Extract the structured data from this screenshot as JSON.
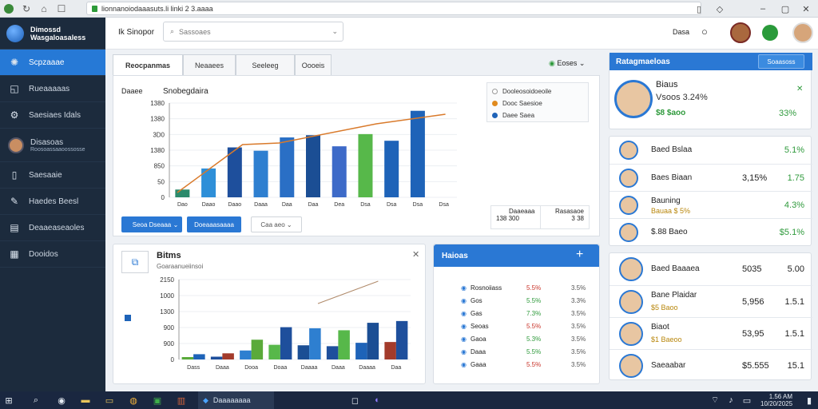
{
  "browser": {
    "url": "lionnanoiodaaasuts.li linki 2 3.aaaa"
  },
  "sidebar": {
    "brand_line1": "Dimossd",
    "brand_line2": "Wasgaloasaless",
    "items": [
      {
        "label": "Scpzaaae",
        "icon": "gear-icon",
        "active": true
      },
      {
        "label": "Rueaaaaas",
        "icon": "chat-icon"
      },
      {
        "label": "Saesiaes Idals",
        "icon": "settings-icon"
      },
      {
        "label": "Disasoas",
        "sub": "Roosoassaaoossosse",
        "icon": "avatar"
      },
      {
        "label": "Saesaaie",
        "icon": "document-icon"
      },
      {
        "label": "Haedes Beesl",
        "icon": "wrench-icon"
      },
      {
        "label": "Deaaeaseaoles",
        "icon": "grid-icon"
      },
      {
        "label": "Dooidos",
        "icon": "calendar-icon"
      }
    ]
  },
  "topbar": {
    "section": "Ik Sinopor",
    "search_placeholder": "Sassoaes",
    "user_label": "Dasa"
  },
  "main_chart": {
    "tabs": [
      "Reocpanmas",
      "Neaaees",
      "Seeleeg",
      "Oooeis"
    ],
    "status": "Eoses",
    "series_label": "Daaee",
    "title": "Snobegdaira",
    "legend_title": "Dooleosoidoeoile",
    "legend": [
      {
        "label": "Dooc Saesioe",
        "color": "#e08a1e"
      },
      {
        "label": "Daee Saea",
        "color": "#1e63b8"
      }
    ],
    "btn_primary": "Seoa Dseaaa",
    "btn_secondary": "Doeaaasaaaa",
    "btn_select": "Caa aeo",
    "stat1_label": "Daaeaaa",
    "stat1_value": "138 300",
    "stat2_label": "Rasasaoe",
    "stat2_value": "3 38"
  },
  "chart_data": [
    {
      "type": "bar",
      "categories": [
        "Dao",
        "Daao",
        "Daao",
        "Daaa",
        "Daa",
        "Daa",
        "Dea",
        "Dsa",
        "Dsa",
        "Dsa",
        "Dsa"
      ],
      "values": [
        140,
        520,
        900,
        840,
        1080,
        1120,
        920,
        1140,
        1020,
        1560,
        0
      ],
      "yticks": [
        "1380",
        "1380",
        "3D0",
        "1380",
        "850",
        "50",
        "0"
      ],
      "ylim": [
        0,
        1700
      ]
    },
    {
      "type": "bar",
      "categories": [
        "Dass",
        "Daaa",
        "Dooa",
        "Doaa",
        "Daaaa",
        "Daaa",
        "Daaaa",
        "Daa"
      ],
      "values": [
        240,
        280,
        900,
        1470,
        1420,
        1330,
        1670,
        1750
      ],
      "yticks": [
        "2150",
        "1000",
        "1300",
        "900",
        "900",
        "0"
      ],
      "ylim": [
        0,
        2000
      ]
    }
  ],
  "chart2_card": {
    "title": "Bitms",
    "subtitle": "Goaraanueiinsoi"
  },
  "points_panel": {
    "title": "Haioas",
    "rows": [
      {
        "label": "Rosnoiiass",
        "v1": "5.5%",
        "v2": "3.5%"
      },
      {
        "label": "Gos",
        "v1": "5.5%",
        "v2": "3.3%"
      },
      {
        "label": "Gas",
        "v1": "7.3%",
        "v2": "3.5%"
      },
      {
        "label": "Seoas",
        "v1": "5.5%",
        "v2": "3.5%"
      },
      {
        "label": "Gaoa",
        "v1": "5.3%",
        "v2": "3.5%"
      },
      {
        "label": "Daaa",
        "v1": "5.5%",
        "v2": "3.5%"
      },
      {
        "label": "Gaaa",
        "v1": "5.5%",
        "v2": "3.5%"
      }
    ]
  },
  "profile_panel": {
    "header": "Ratagmaeloas",
    "action": "Soaasoss",
    "hero_name": "Biaus",
    "hero_sub": "Vsoos 3.24%",
    "hero_val": "$8 $aoo",
    "hero_pct": "33%",
    "group1": [
      {
        "name": "Baed Bslaa",
        "v1": "",
        "v2": "5.1%"
      },
      {
        "name": "Baes Biaan",
        "v1": "3,15%",
        "v2": "1.75"
      },
      {
        "name": "Bauning",
        "sub": "Bauaa $ 5%",
        "v1": "",
        "v2": "4.3%"
      },
      {
        "name": "$.88 Baeo",
        "v1": "",
        "v2": "$5.1%"
      }
    ],
    "group2": [
      {
        "name": "Baed Baaaea",
        "v1": "5035",
        "v2": "5.00"
      },
      {
        "name": "Bane Plaidar",
        "sub": "$5 Baoo",
        "v1": "5,956",
        "v2": "1.5.1"
      },
      {
        "name": "Biaot",
        "sub": "$1 Baeoo",
        "v1": "53,95",
        "v2": "1.5.1"
      },
      {
        "name": "Saeaabar",
        "sub": "",
        "v1": "$5.555",
        "v2": "15.1"
      }
    ]
  },
  "taskbar": {
    "app_label": "Daaaaaaaa",
    "time": "1.56 AM",
    "date": "10/20/2025"
  }
}
